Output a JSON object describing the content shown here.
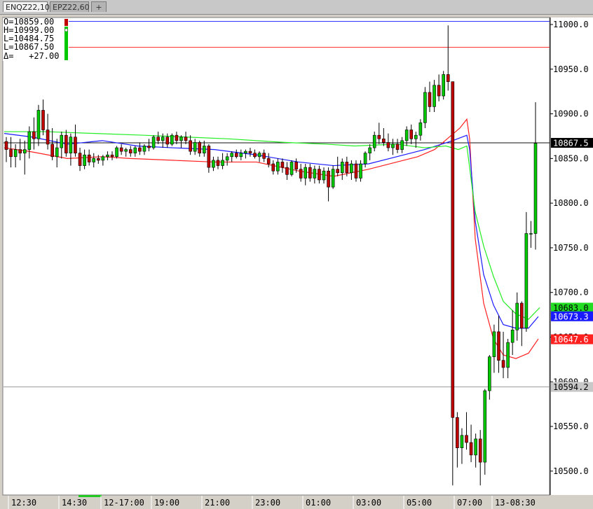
{
  "tabs": [
    {
      "label": "ENQZ22,10",
      "active": true
    },
    {
      "label": "EPZ22,60",
      "active": false
    }
  ],
  "add_tab_label": "+",
  "ohlc": {
    "open": "O=10859.00",
    "high": "H=10999.00",
    "low": "L=10484.75",
    "last": "L=10867.50",
    "delta": "Δ=   +27.00"
  },
  "colors": {
    "up": "#00c800",
    "down": "#c00000",
    "ma_red": "#ff2020",
    "ma_blue": "#1a1aff",
    "ma_green": "#22ee22",
    "hline_blue": "#3333ff",
    "hline_red": "#ff3333"
  },
  "chart_data": {
    "type": "candlestick",
    "y_ticks": [
      "11000.0",
      "10950.0",
      "10900.0",
      "10850.0",
      "10800.0",
      "10750.0",
      "10700.0",
      "10650.0",
      "10600.0",
      "10550.0",
      "10500.0"
    ],
    "ylim": [
      10478,
      11002
    ],
    "x_ticks": [
      "12:30",
      "14:30",
      "12-17:00",
      "19:00",
      "21:00",
      "23:00",
      "01:00",
      "03:00",
      "05:00",
      "07:00",
      "13-08:30"
    ],
    "price_labels": [
      {
        "text": "10867.5",
        "value": 10867.5,
        "style": "last"
      },
      {
        "text": "10683.0",
        "value": 10683.0,
        "style": "green"
      },
      {
        "text": "10673.3",
        "value": 10673.3,
        "style": "blue"
      },
      {
        "text": "10647.6",
        "value": 10647.6,
        "style": "red"
      },
      {
        "text": "10594.2",
        "value": 10594.2,
        "style": "gray"
      }
    ],
    "horizontal_lines": [
      {
        "value": 11003.5,
        "color": "blue"
      },
      {
        "value": 10974.5,
        "color": "red"
      },
      {
        "value": 10867.5,
        "color": "black"
      },
      {
        "value": 10594.2,
        "color": "gray"
      }
    ],
    "candles": [
      [
        10869,
        10874,
        10846,
        10860
      ],
      [
        10860,
        10874,
        10840,
        10852
      ],
      [
        10852,
        10866,
        10840,
        10860
      ],
      [
        10860,
        10872,
        10848,
        10856
      ],
      [
        10856,
        10870,
        10832,
        10860
      ],
      [
        10860,
        10886,
        10850,
        10880
      ],
      [
        10880,
        10896,
        10860,
        10872
      ],
      [
        10872,
        10910,
        10864,
        10904
      ],
      [
        10904,
        10916,
        10876,
        10882
      ],
      [
        10882,
        10900,
        10860,
        10866
      ],
      [
        10866,
        10884,
        10848,
        10852
      ],
      [
        10852,
        10872,
        10840,
        10862
      ],
      [
        10862,
        10880,
        10850,
        10876
      ],
      [
        10876,
        10882,
        10852,
        10856
      ],
      [
        10856,
        10878,
        10842,
        10874
      ],
      [
        10874,
        10888,
        10852,
        10856
      ],
      [
        10856,
        10862,
        10836,
        10842
      ],
      [
        10842,
        10860,
        10838,
        10854
      ],
      [
        10854,
        10860,
        10842,
        10846
      ],
      [
        10846,
        10856,
        10840,
        10850
      ],
      [
        10850,
        10854,
        10844,
        10848
      ],
      [
        10848,
        10854,
        10842,
        10852
      ],
      [
        10852,
        10858,
        10848,
        10854
      ],
      [
        10854,
        10858,
        10848,
        10852
      ],
      [
        10852,
        10864,
        10850,
        10862
      ],
      [
        10862,
        10866,
        10854,
        10858
      ],
      [
        10858,
        10862,
        10852,
        10860
      ],
      [
        10860,
        10864,
        10852,
        10856
      ],
      [
        10856,
        10864,
        10852,
        10862
      ],
      [
        10862,
        10868,
        10854,
        10858
      ],
      [
        10858,
        10866,
        10854,
        10864
      ],
      [
        10864,
        10872,
        10858,
        10862
      ],
      [
        10862,
        10876,
        10860,
        10874
      ],
      [
        10874,
        10880,
        10866,
        10870
      ],
      [
        10870,
        10878,
        10862,
        10874
      ],
      [
        10874,
        10878,
        10862,
        10866
      ],
      [
        10866,
        10878,
        10864,
        10876
      ],
      [
        10876,
        10880,
        10866,
        10870
      ],
      [
        10870,
        10876,
        10862,
        10874
      ],
      [
        10874,
        10880,
        10866,
        10870
      ],
      [
        10870,
        10876,
        10854,
        10858
      ],
      [
        10858,
        10872,
        10854,
        10868
      ],
      [
        10868,
        10870,
        10852,
        10856
      ],
      [
        10856,
        10870,
        10852,
        10864
      ],
      [
        10864,
        10866,
        10834,
        10840
      ],
      [
        10840,
        10852,
        10836,
        10848
      ],
      [
        10848,
        10852,
        10838,
        10842
      ],
      [
        10842,
        10856,
        10838,
        10848
      ],
      [
        10848,
        10856,
        10842,
        10852
      ],
      [
        10852,
        10858,
        10846,
        10856
      ],
      [
        10856,
        10860,
        10850,
        10852
      ],
      [
        10852,
        10860,
        10848,
        10856
      ],
      [
        10856,
        10860,
        10850,
        10858
      ],
      [
        10858,
        10862,
        10852,
        10856
      ],
      [
        10856,
        10860,
        10850,
        10852
      ],
      [
        10852,
        10858,
        10846,
        10856
      ],
      [
        10856,
        10860,
        10846,
        10850
      ],
      [
        10850,
        10856,
        10840,
        10844
      ],
      [
        10844,
        10848,
        10832,
        10836
      ],
      [
        10836,
        10850,
        10832,
        10846
      ],
      [
        10846,
        10850,
        10834,
        10840
      ],
      [
        10840,
        10846,
        10826,
        10832
      ],
      [
        10832,
        10848,
        10830,
        10846
      ],
      [
        10846,
        10850,
        10834,
        10838
      ],
      [
        10838,
        10844,
        10824,
        10828
      ],
      [
        10828,
        10844,
        10820,
        10840
      ],
      [
        10840,
        10844,
        10824,
        10828
      ],
      [
        10828,
        10842,
        10822,
        10838
      ],
      [
        10838,
        10842,
        10822,
        10826
      ],
      [
        10826,
        10840,
        10822,
        10836
      ],
      [
        10836,
        10840,
        10802,
        10818
      ],
      [
        10818,
        10842,
        10816,
        10838
      ],
      [
        10838,
        10852,
        10830,
        10834
      ],
      [
        10834,
        10850,
        10826,
        10846
      ],
      [
        10846,
        10852,
        10830,
        10834
      ],
      [
        10834,
        10848,
        10826,
        10844
      ],
      [
        10844,
        10848,
        10824,
        10828
      ],
      [
        10828,
        10848,
        10824,
        10844
      ],
      [
        10844,
        10858,
        10840,
        10856
      ],
      [
        10856,
        10866,
        10848,
        10862
      ],
      [
        10862,
        10880,
        10858,
        10876
      ],
      [
        10876,
        10890,
        10866,
        10872
      ],
      [
        10872,
        10884,
        10864,
        10868
      ],
      [
        10868,
        10878,
        10858,
        10862
      ],
      [
        10862,
        10872,
        10854,
        10866
      ],
      [
        10866,
        10872,
        10856,
        10860
      ],
      [
        10860,
        10874,
        10856,
        10870
      ],
      [
        10870,
        10886,
        10864,
        10882
      ],
      [
        10882,
        10888,
        10866,
        10872
      ],
      [
        10872,
        10880,
        10862,
        10876
      ],
      [
        10876,
        10894,
        10870,
        10890
      ],
      [
        10890,
        10930,
        10884,
        10924
      ],
      [
        10924,
        10936,
        10902,
        10908
      ],
      [
        10908,
        10938,
        10902,
        10932
      ],
      [
        10932,
        10944,
        10914,
        10920
      ],
      [
        10920,
        10948,
        10916,
        10944
      ],
      [
        10944,
        10999,
        10926,
        10936
      ],
      [
        10936,
        10936,
        10484,
        10560
      ],
      [
        10560,
        10566,
        10504,
        10526
      ],
      [
        10526,
        10548,
        10508,
        10540
      ],
      [
        10540,
        10566,
        10524,
        10532
      ],
      [
        10532,
        10552,
        10510,
        10518
      ],
      [
        10518,
        10542,
        10504,
        10536
      ],
      [
        10536,
        10546,
        10484,
        10510
      ],
      [
        10510,
        10592,
        10496,
        10590
      ],
      [
        10590,
        10630,
        10580,
        10628
      ],
      [
        10628,
        10664,
        10610,
        10656
      ],
      [
        10656,
        10674,
        10610,
        10624
      ],
      [
        10624,
        10656,
        10604,
        10616
      ],
      [
        10616,
        10648,
        10604,
        10644
      ],
      [
        10644,
        10680,
        10630,
        10658
      ],
      [
        10658,
        10700,
        10646,
        10688
      ],
      [
        10688,
        10690,
        10640,
        10660
      ],
      [
        10660,
        10790,
        10656,
        10766
      ],
      [
        10766,
        10780,
        10750,
        10766
      ],
      [
        10766,
        10913,
        10748,
        10867
      ]
    ],
    "series": [
      {
        "name": "",
        "color": "red",
        "values": [
          [
            0,
            10862
          ],
          [
            35,
            10858
          ],
          [
            90,
            10850
          ],
          [
            140,
            10852
          ],
          [
            180,
            10850
          ],
          [
            240,
            10848
          ],
          [
            300,
            10846
          ],
          [
            360,
            10846
          ],
          [
            420,
            10836
          ],
          [
            470,
            10830
          ],
          [
            520,
            10838
          ],
          [
            540,
            10842
          ],
          [
            560,
            10846
          ],
          [
            590,
            10852
          ],
          [
            614,
            10860
          ],
          [
            632,
            10872
          ],
          [
            650,
            10884
          ],
          [
            660,
            10894
          ],
          [
            664,
            10872
          ],
          [
            672,
            10760
          ],
          [
            684,
            10688
          ],
          [
            698,
            10648
          ],
          [
            712,
            10630
          ],
          [
            730,
            10626
          ],
          [
            748,
            10632
          ],
          [
            762,
            10648
          ]
        ]
      },
      {
        "name": "",
        "color": "blue",
        "values": [
          [
            0,
            10878
          ],
          [
            40,
            10874
          ],
          [
            90,
            10866
          ],
          [
            140,
            10870
          ],
          [
            190,
            10864
          ],
          [
            240,
            10862
          ],
          [
            300,
            10860
          ],
          [
            360,
            10854
          ],
          [
            420,
            10846
          ],
          [
            470,
            10842
          ],
          [
            520,
            10844
          ],
          [
            560,
            10852
          ],
          [
            600,
            10860
          ],
          [
            640,
            10870
          ],
          [
            660,
            10876
          ],
          [
            664,
            10860
          ],
          [
            672,
            10780
          ],
          [
            684,
            10720
          ],
          [
            698,
            10686
          ],
          [
            712,
            10664
          ],
          [
            730,
            10660
          ],
          [
            748,
            10660
          ],
          [
            762,
            10673
          ]
        ]
      },
      {
        "name": "",
        "color": "green",
        "values": [
          [
            0,
            10880
          ],
          [
            60,
            10880
          ],
          [
            130,
            10878
          ],
          [
            200,
            10876
          ],
          [
            260,
            10874
          ],
          [
            320,
            10872
          ],
          [
            400,
            10868
          ],
          [
            460,
            10866
          ],
          [
            500,
            10864
          ],
          [
            560,
            10866
          ],
          [
            600,
            10862
          ],
          [
            630,
            10864
          ],
          [
            648,
            10860
          ],
          [
            660,
            10864
          ],
          [
            664,
            10840
          ],
          [
            672,
            10790
          ],
          [
            684,
            10752
          ],
          [
            698,
            10718
          ],
          [
            712,
            10690
          ],
          [
            730,
            10676
          ],
          [
            748,
            10670
          ],
          [
            764,
            10683
          ]
        ]
      }
    ]
  }
}
